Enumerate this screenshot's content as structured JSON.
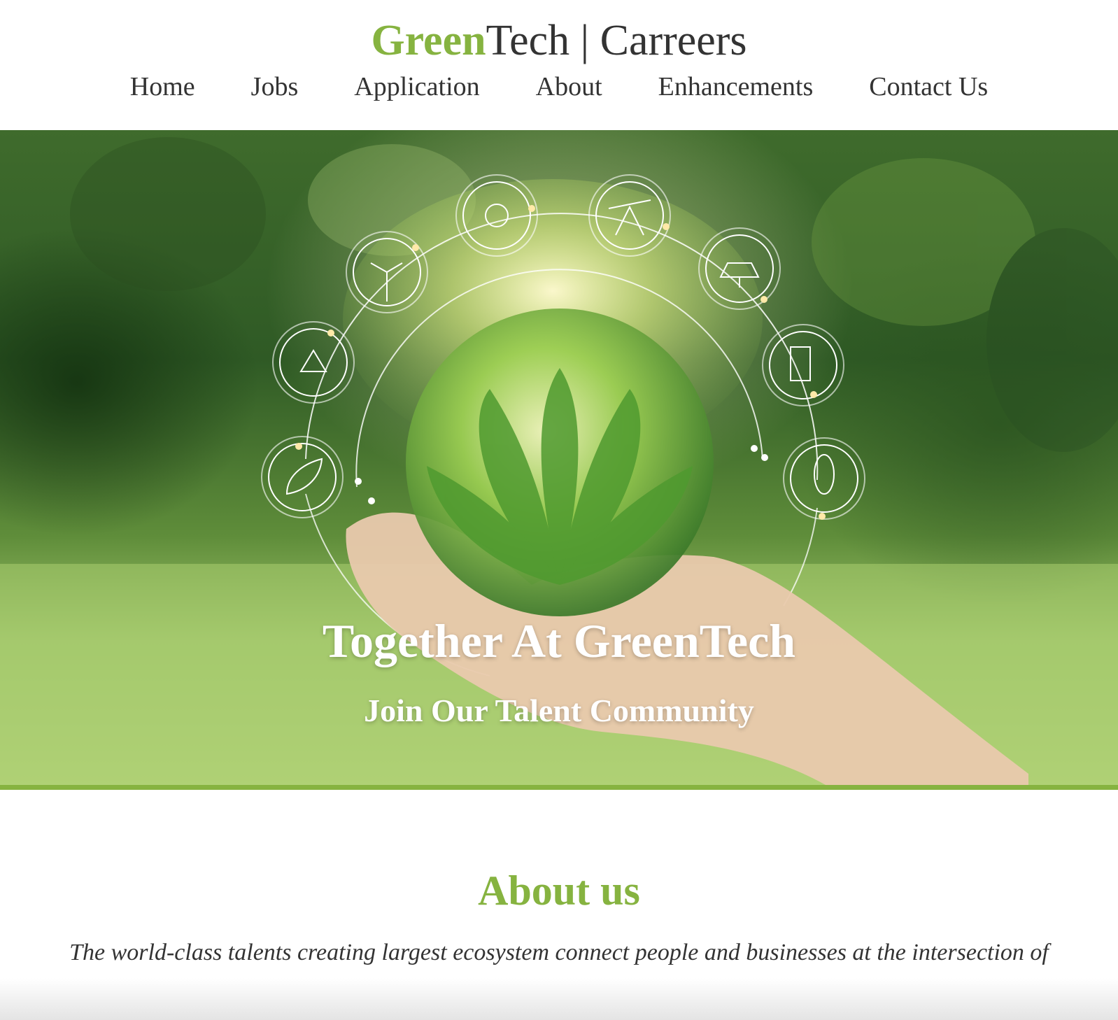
{
  "header": {
    "brand_green": "Green",
    "brand_rest": "Tech | Carreers",
    "nav": [
      "Home",
      "Jobs",
      "Application",
      "About",
      "Enhancements",
      "Contact Us"
    ]
  },
  "hero": {
    "title": "Together At GreenTech",
    "subtitle": "Join Our Talent Community",
    "icons": [
      "leaf-water-icon",
      "recycle-icon",
      "wind-turbine-icon",
      "sun-icon",
      "oil-pump-icon",
      "solar-panel-icon",
      "fuel-pump-icon",
      "corn-icon"
    ]
  },
  "about": {
    "heading": "About us",
    "text": "The world-class talents creating largest ecosystem connect people and businesses at the intersection of"
  },
  "colors": {
    "accent": "#86b340",
    "text": "#333333"
  }
}
